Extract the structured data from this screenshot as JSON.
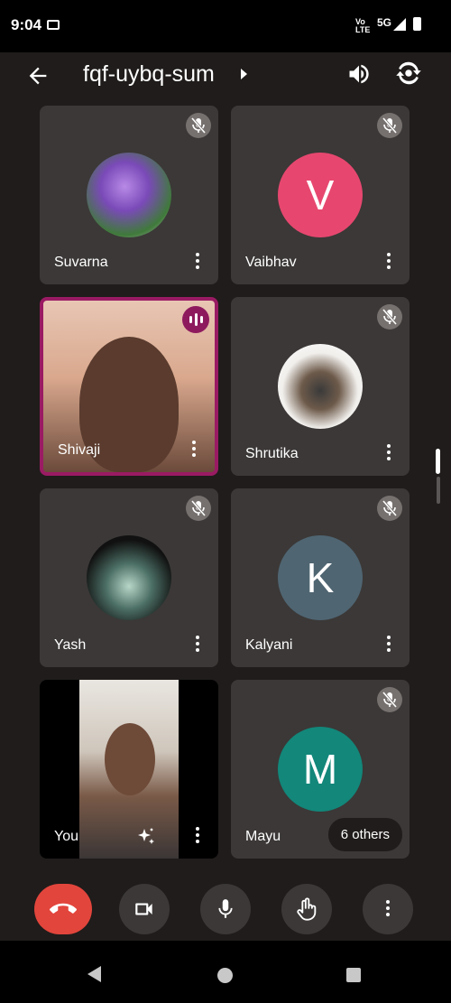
{
  "status_bar": {
    "time": "9:04",
    "network_small": "Vo¹\nLTE",
    "network_5g": "5G"
  },
  "app_bar": {
    "meeting_code": "fqf-uybq-sum"
  },
  "participants": [
    {
      "name": "Suvarna",
      "avatar": "purple-roses-photo",
      "muted": true
    },
    {
      "name": "Vaibhav",
      "avatar_letter": "V",
      "avatar_color": "#e7476f",
      "muted": true
    },
    {
      "name": "Shivaji",
      "video": true,
      "speaking": true
    },
    {
      "name": "Shrutika",
      "avatar": "statue-photo",
      "muted": true
    },
    {
      "name": "Yash",
      "avatar": "man-photo",
      "muted": true
    },
    {
      "name": "Kalyani",
      "avatar_letter": "K",
      "avatar_color": "#4f6572",
      "muted": true
    },
    {
      "name": "You",
      "video": true,
      "self": true
    },
    {
      "name": "Mayu",
      "avatar_letter": "M",
      "avatar_color": "#12877a",
      "muted": true
    }
  ],
  "others_label": "6 others",
  "colors": {
    "background": "#1f1c1b",
    "tile": "#3b3837",
    "end_call": "#e2453c",
    "speaking": "#8e1a5e"
  },
  "controls": [
    "end-call",
    "camera",
    "microphone",
    "raise-hand",
    "more-options"
  ]
}
